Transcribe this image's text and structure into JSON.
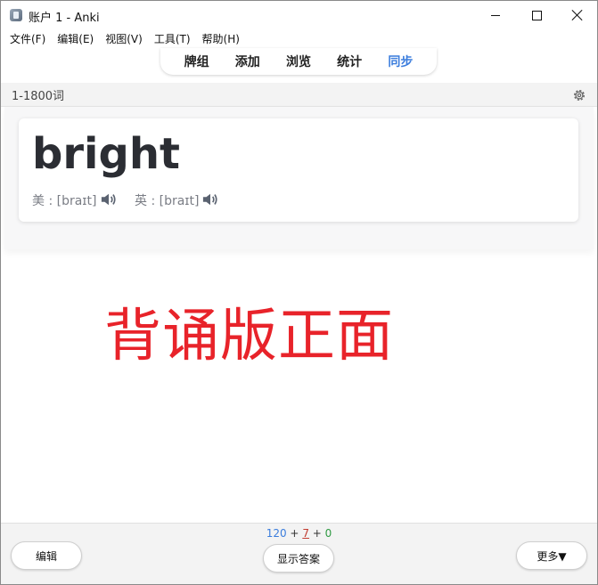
{
  "window": {
    "title": "账户 1 - Anki"
  },
  "menu": [
    "文件(F)",
    "编辑(E)",
    "视图(V)",
    "工具(T)",
    "帮助(H)"
  ],
  "toolbar": {
    "decks": "牌组",
    "add": "添加",
    "browse": "浏览",
    "stats": "统计",
    "sync": "同步"
  },
  "deck": {
    "name": "1-1800词"
  },
  "card": {
    "word": "bright",
    "us_phonetic": "美 : [braɪt]",
    "uk_phonetic": "英 : [braɪt]"
  },
  "overlay_label": "背诵版正面",
  "counts": {
    "new": "120",
    "learn": "7",
    "review": "0",
    "sep": "+"
  },
  "buttons": {
    "edit": "编辑",
    "show_answer": "显示答案",
    "more": "更多▼"
  },
  "colors": {
    "sync": "#3b7ddd",
    "new": "#3b7ddd",
    "learn": "#c23b30",
    "review": "#2f9a43",
    "label": "#e8232a"
  },
  "icons": [
    "anki-app-icon",
    "minimize-icon",
    "maximize-icon",
    "close-icon",
    "gear-icon",
    "speaker-icon"
  ]
}
